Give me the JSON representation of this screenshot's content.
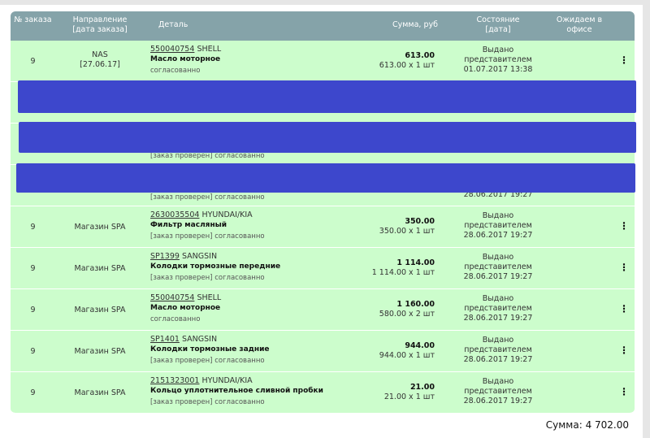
{
  "header": {
    "num": "№ заказа",
    "direction": "Направление [дата заказа]",
    "detail": "Деталь",
    "sum": "Сумма, руб",
    "state": "Состояние [дата]",
    "expected": "Ожидаем в офисе"
  },
  "rows": [
    {
      "num": "9",
      "direction": "NAS",
      "date": "[27.06.17]",
      "code": "550040754",
      "brand": "SHELL",
      "name": "Масло моторное",
      "status": "согласованно",
      "sum": "613.00",
      "calc": "613.00 x 1 шт",
      "state": "Выдано представителем",
      "state_date": "01.07.2017 13:38"
    },
    {
      "redacted": true
    },
    {
      "redacted": true,
      "status": "[заказ проверен] согласованно"
    },
    {
      "redacted": true,
      "status": "[заказ проверен] согласованно",
      "state_date": "28.06.2017 19:27"
    },
    {
      "num": "9",
      "direction": "Магазин SPA",
      "code": "2630035504",
      "brand": "HYUNDAI/KIA",
      "name": "Фильтр масляный",
      "status": "[заказ проверен] согласованно",
      "sum": "350.00",
      "calc": "350.00 x 1 шт",
      "state": "Выдано представителем",
      "state_date": "28.06.2017 19:27"
    },
    {
      "num": "9",
      "direction": "Магазин SPA",
      "code": "SP1399",
      "brand": "SANGSIN",
      "name": "Колодки тормозные передние",
      "status": "[заказ проверен] согласованно",
      "sum": "1 114.00",
      "calc": "1 114.00 x 1 шт",
      "state": "Выдано представителем",
      "state_date": "28.06.2017 19:27"
    },
    {
      "num": "9",
      "direction": "Магазин SPA",
      "code": "550040754",
      "brand": "SHELL",
      "name": "Масло моторное",
      "status": "согласованно",
      "sum": "1 160.00",
      "calc": "580.00 x 2 шт",
      "state": "Выдано представителем",
      "state_date": "28.06.2017 19:27"
    },
    {
      "num": "9",
      "direction": "Магазин SPA",
      "code": "SP1401",
      "brand": "SANGSIN",
      "name": "Колодки тормозные задние",
      "status": "[заказ проверен] согласованно",
      "sum": "944.00",
      "calc": "944.00 x 1 шт",
      "state": "Выдано представителем",
      "state_date": "28.06.2017 19:27"
    },
    {
      "num": "9",
      "direction": "Магазин SPA",
      "code": "2151323001",
      "brand": "HYUNDAI/KIA",
      "name": "Кольцо уплотнительное сливной пробки",
      "status": "[заказ проверен] согласованно",
      "sum": "21.00",
      "calc": "21.00 x 1 шт",
      "state": "Выдано представителем",
      "state_date": "28.06.2017 19:27"
    }
  ],
  "total": "Сумма: 4 702.00",
  "colors": {
    "header": "#85a3a9",
    "row": "#ccfdcc",
    "redaction": "#3d47cc"
  }
}
